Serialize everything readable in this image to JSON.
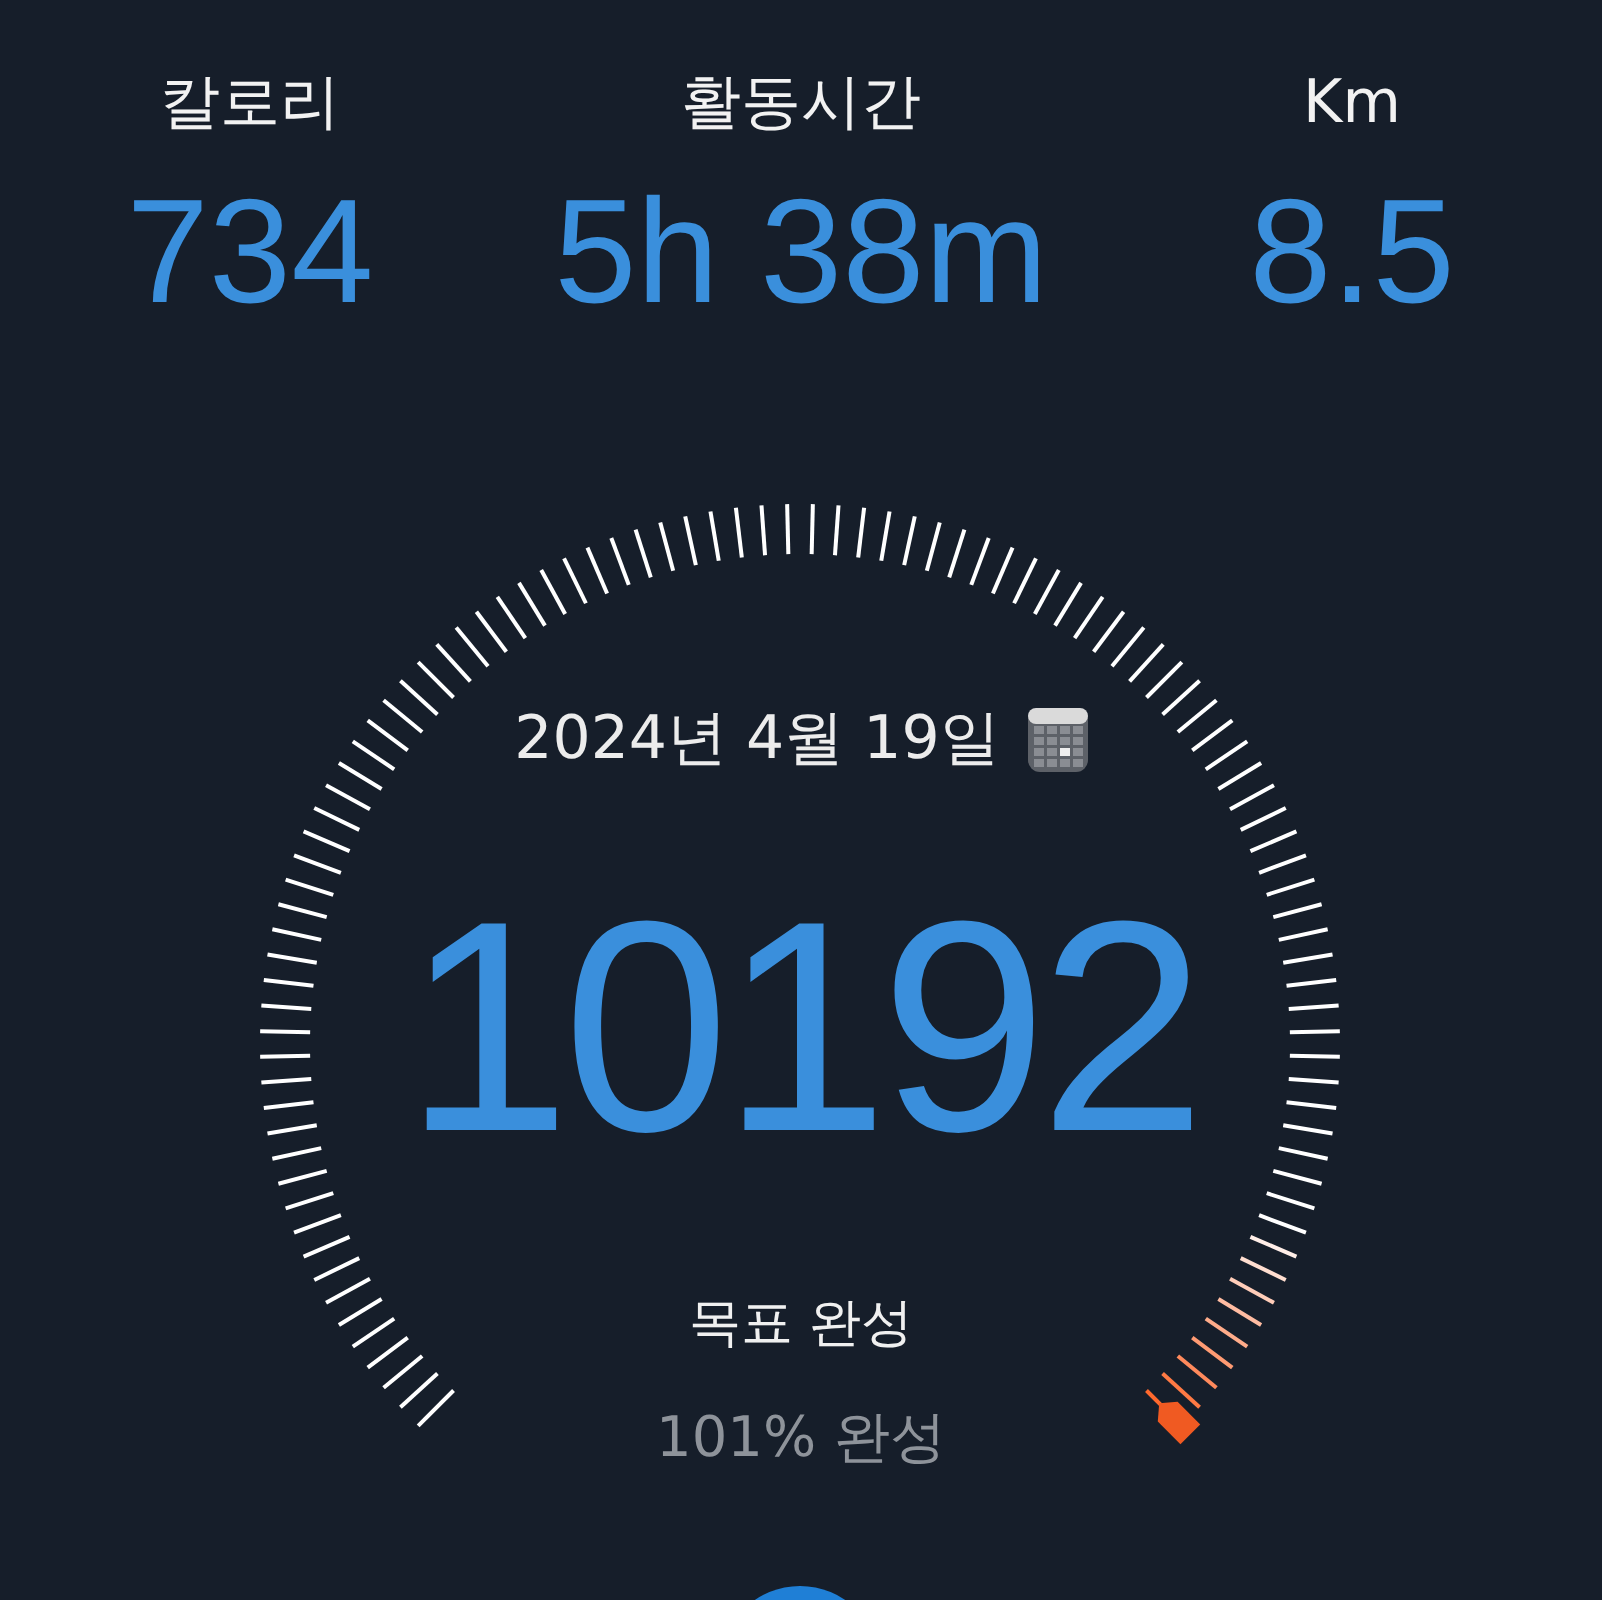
{
  "stats": [
    {
      "label": "칼로리",
      "value": "734"
    },
    {
      "label": "활동시간",
      "value": "5h 38m"
    },
    {
      "label": "Km",
      "value": "8.5"
    }
  ],
  "gauge": {
    "date": "2024년 4월 19일",
    "steps": "10192",
    "goal_label": "목표 완성",
    "progress_text": "101% 완성"
  }
}
